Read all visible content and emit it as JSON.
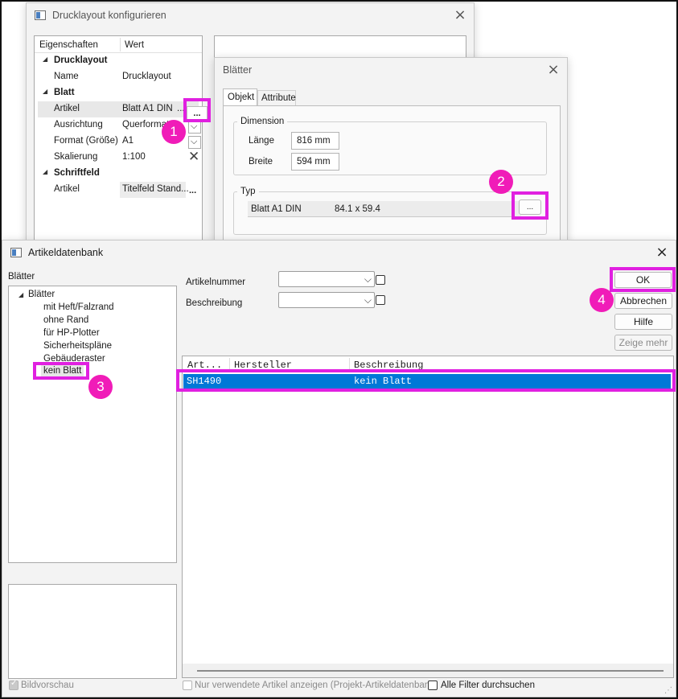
{
  "drucklayout_window": {
    "title": "Drucklayout konfigurieren",
    "columns": {
      "property": "Eigenschaften",
      "value": "Wert"
    },
    "groups": {
      "drucklayout": "Drucklayout",
      "blatt": "Blatt",
      "schriftfeld": "Schriftfeld"
    },
    "rows": {
      "name": {
        "label": "Name",
        "value": "Drucklayout"
      },
      "artikel": {
        "label": "Artikel",
        "value": "Blatt A1 DIN",
        "more": "...",
        "button": "..."
      },
      "ausrichtung": {
        "label": "Ausrichtung",
        "value": "Querformat"
      },
      "format": {
        "label": "Format (Größe)",
        "value": "A1"
      },
      "skalierung": {
        "label": "Skalierung",
        "value": "1:100"
      },
      "sf_artikel": {
        "label": "Artikel",
        "value": "Titelfeld Stand...",
        "button": "..."
      }
    }
  },
  "blaetter_window": {
    "title": "Blätter",
    "tabs": {
      "objekt": "Objekt",
      "attribute": "Attribute"
    },
    "dimension_group": "Dimension",
    "laenge": {
      "label": "Länge",
      "value": "816 mm"
    },
    "breite": {
      "label": "Breite",
      "value": "594 mm"
    },
    "typ_group": "Typ",
    "typ_name": "Blatt A1 DIN",
    "typ_size": "84.1 x 59.4",
    "browse_button": "..."
  },
  "artikeldatenbank_window": {
    "title": "Artikeldatenbank",
    "tree_label": "Blätter",
    "tree_root": "Blätter",
    "tree_items": [
      "mit Heft/Falzrand",
      "ohne Rand",
      "für HP-Plotter",
      "Sicherheitspläne",
      "Gebäuderaster",
      "kein Blatt"
    ],
    "filter_artikelnummer": "Artikelnummer",
    "filter_beschreibung": "Beschreibung",
    "buttons": {
      "ok": "OK",
      "abbrechen": "Abbrechen",
      "hilfe": "Hilfe",
      "zeige_mehr": "Zeige mehr"
    },
    "table_headers": [
      "Art...",
      "Hersteller",
      "Beschreibung"
    ],
    "table_rows": [
      {
        "art": "SH1490",
        "hersteller": "",
        "beschreibung": "kein Blatt"
      }
    ],
    "bildvorschau": "Bildvorschau",
    "nur_verwendete": "Nur verwendete Artikel anzeigen (Projekt-Artikeldatenbank)",
    "alle_filter": "Alle Filter durchsuchen"
  },
  "badges": [
    "1",
    "2",
    "3",
    "4"
  ],
  "colors": {
    "highlight": "#e020e0",
    "badge": "#f01cb8",
    "selection": "#0078d7"
  }
}
